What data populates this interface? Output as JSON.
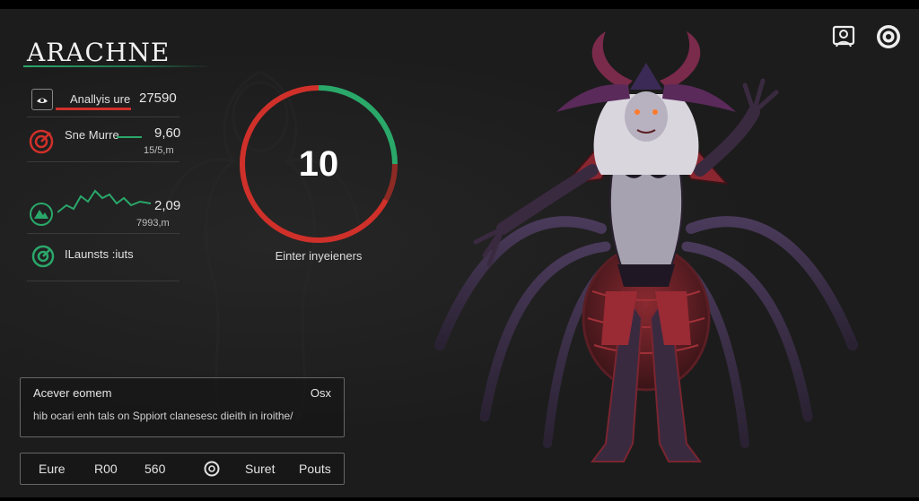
{
  "header": {
    "title": "ARACHNE"
  },
  "stats": [
    {
      "label": "Anallyis ure",
      "value": "27590",
      "sub": ""
    },
    {
      "label": "Sne Murre",
      "value": "9,60",
      "sub": "15/5,m"
    },
    {
      "label": "",
      "value": "2,09",
      "sub": "7993,m"
    },
    {
      "label": "ILaunsts :iuts",
      "value": "",
      "sub": ""
    }
  ],
  "gauge": {
    "value": "10",
    "caption": "Einter inyeieners",
    "fraction": 0.62
  },
  "description": {
    "title": "Acever eomem",
    "extra": "Osx",
    "body": "hib ocari enh tals on Sppiort clanesesc dieith in iroithe/"
  },
  "footer": {
    "items": [
      "Eure",
      "R00",
      "560",
      "Suret",
      "Pouts"
    ]
  },
  "colors": {
    "accent_green": "#2aa86a",
    "accent_red": "#d0302a",
    "bg": "#1c1c1c"
  },
  "icons": {
    "top_right": [
      "portrait-icon",
      "target-icon"
    ],
    "stats": [
      "eye-icon",
      "target-icon",
      "mountain-icon",
      "target-icon"
    ]
  }
}
